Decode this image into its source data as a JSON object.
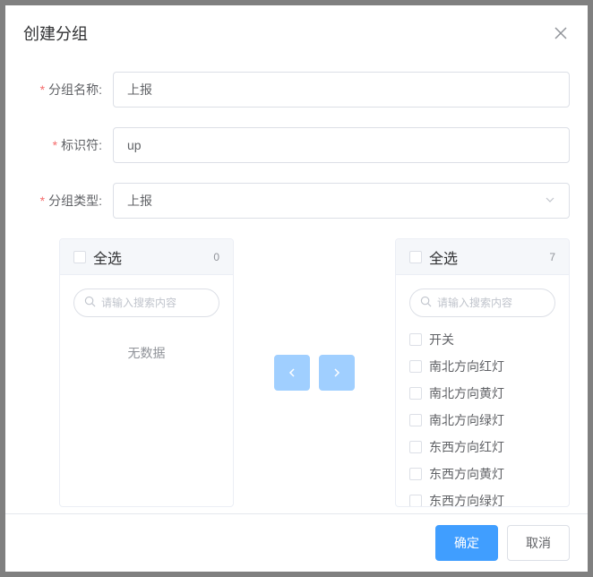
{
  "modal": {
    "title": "创建分组",
    "confirm_label": "确定",
    "cancel_label": "取消"
  },
  "form": {
    "name_label": "分组名称:",
    "name_value": "上报",
    "identifier_label": "标识符:",
    "identifier_value": "up",
    "type_label": "分组类型:",
    "type_value": "上报"
  },
  "transfer": {
    "select_all_label": "全选",
    "search_placeholder": "请输入搜索内容",
    "empty_text": "无数据",
    "left": {
      "count": "0",
      "items": []
    },
    "right": {
      "count": "7",
      "items": [
        "开关",
        "南北方向红灯",
        "南北方向黄灯",
        "南北方向绿灯",
        "东西方向红灯",
        "东西方向黄灯",
        "东西方向绿灯"
      ]
    }
  }
}
